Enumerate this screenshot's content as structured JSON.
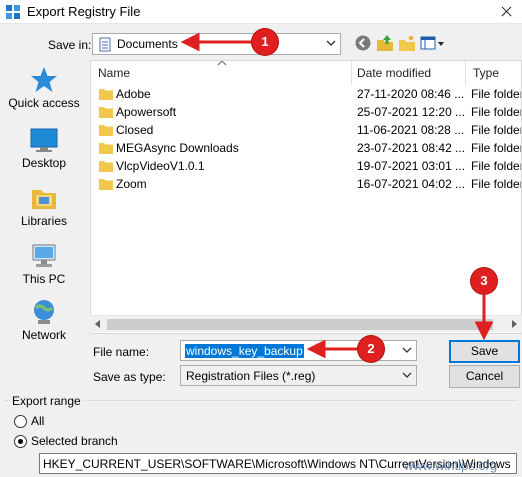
{
  "window": {
    "title": "Export Registry File"
  },
  "save_in": {
    "label": "Save in:",
    "value": "Documents"
  },
  "places": [
    {
      "label": "Quick access",
      "icon": "star-icon"
    },
    {
      "label": "Desktop",
      "icon": "desktop-icon"
    },
    {
      "label": "Libraries",
      "icon": "libraries-icon"
    },
    {
      "label": "This PC",
      "icon": "computer-icon"
    },
    {
      "label": "Network",
      "icon": "network-icon"
    }
  ],
  "columns": {
    "name": "Name",
    "date": "Date modified",
    "type": "Type"
  },
  "files": [
    {
      "name": "Adobe",
      "date": "27-11-2020 08:46 ...",
      "type": "File folder"
    },
    {
      "name": "Apowersoft",
      "date": "25-07-2021 12:20 ...",
      "type": "File folder"
    },
    {
      "name": "Closed",
      "date": "11-06-2021 08:28 ...",
      "type": "File folder"
    },
    {
      "name": "MEGAsync Downloads",
      "date": "23-07-2021 08:42 ...",
      "type": "File folder"
    },
    {
      "name": "VlcpVideoV1.0.1",
      "date": "19-07-2021 03:01 ...",
      "type": "File folder"
    },
    {
      "name": "Zoom",
      "date": "16-07-2021 04:02 ...",
      "type": "File folder"
    }
  ],
  "file_name": {
    "label": "File name:",
    "value": "windows_key_backup"
  },
  "save_as_type": {
    "label": "Save as type:",
    "value": "Registration Files (*.reg)"
  },
  "buttons": {
    "save": "Save",
    "cancel": "Cancel"
  },
  "export_range": {
    "label": "Export range",
    "all": "All",
    "selected": "Selected branch",
    "branch_value": "HKEY_CURRENT_USER\\SOFTWARE\\Microsoft\\Windows NT\\CurrentVersion\\Windows"
  },
  "annotations": {
    "one": "1",
    "two": "2",
    "three": "3"
  },
  "watermark": "www.wintips.org",
  "colors": {
    "accent": "#0078d7",
    "annotation": "#e02020",
    "folder": "#f2c84b"
  }
}
